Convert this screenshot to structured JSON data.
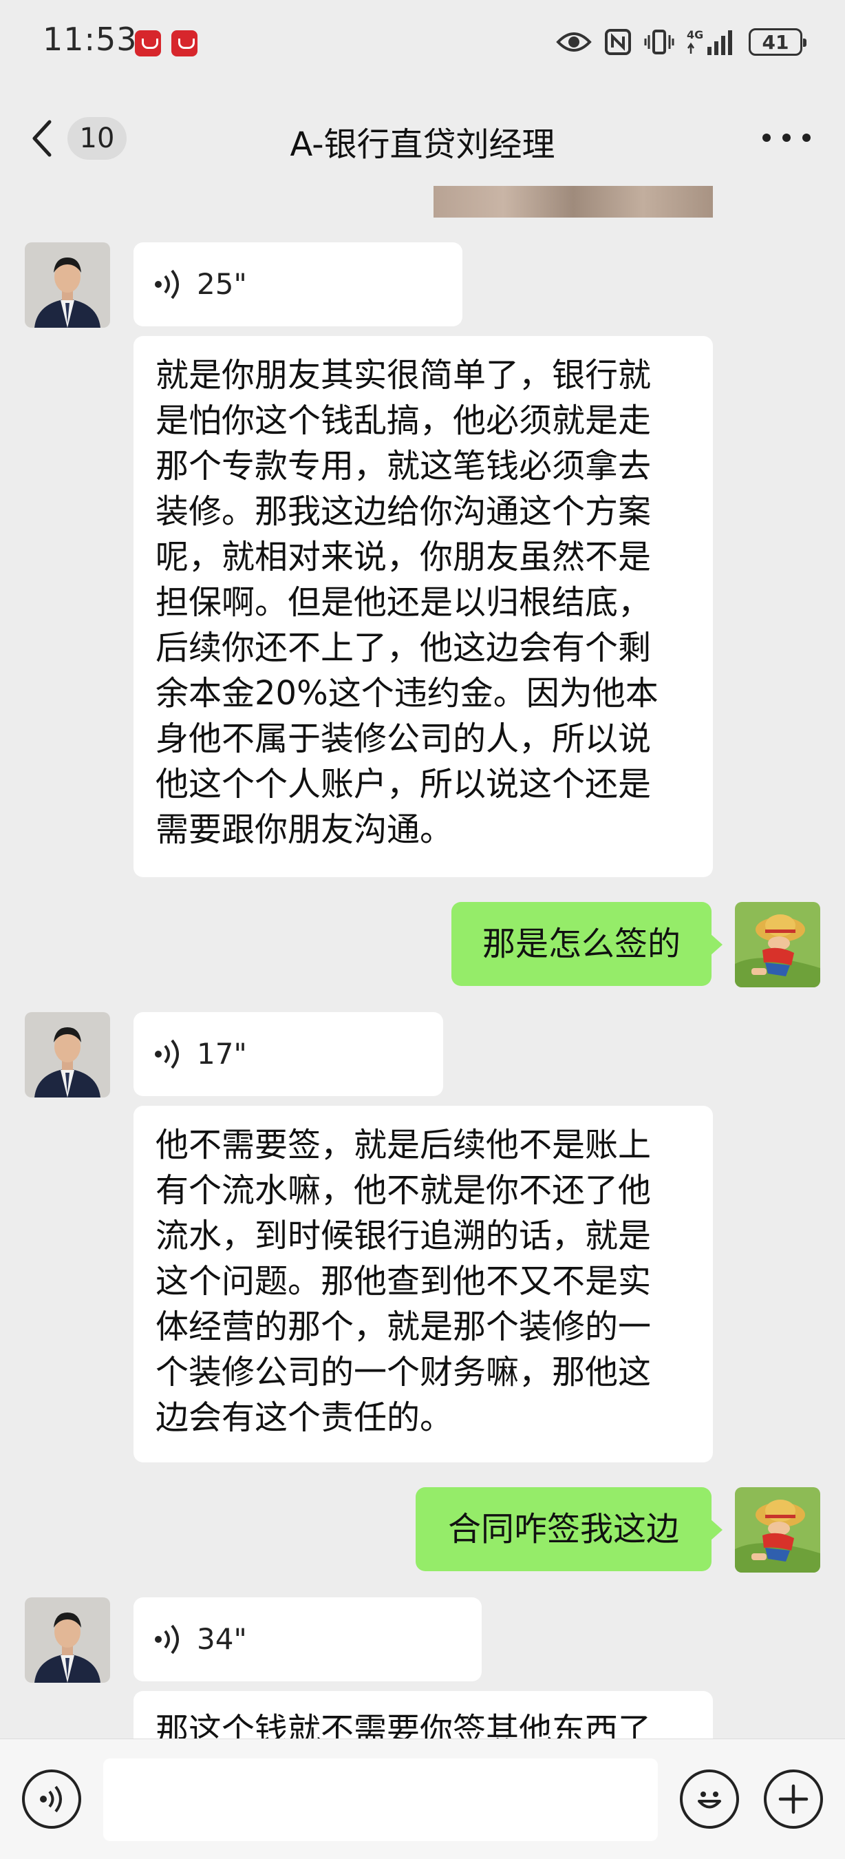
{
  "status_bar": {
    "time": "11:53",
    "battery": "41",
    "icons": [
      "huawei-app-icon",
      "huawei-app-icon",
      "eye-icon",
      "nfc-icon",
      "vibrate-icon",
      "4g-signal-icon",
      "battery-icon"
    ]
  },
  "nav": {
    "unread_count": "10",
    "title": "A-银行直贷刘经理"
  },
  "messages": [
    {
      "side": "left",
      "type": "voice",
      "duration": "25\""
    },
    {
      "side": "left",
      "type": "text",
      "text": "就是你朋友其实很简单了，银行就\n是怕你这个钱乱搞，他必须就是走\n那个专款专用，就这笔钱必须拿去\n装修。那我这边给你沟通这个方案\n呢，就相对来说，你朋友虽然不是\n担保啊。但是他还是以归根结底，\n后续你还不上了，他这边会有个剩\n余本金20%这个违约金。因为他本\n身他不属于装修公司的人，所以说\n他这个个人账户，所以说这个还是\n需要跟你朋友沟通。"
    },
    {
      "side": "right",
      "type": "text",
      "text": "那是怎么签的"
    },
    {
      "side": "left",
      "type": "voice",
      "duration": "17\""
    },
    {
      "side": "left",
      "type": "text",
      "text": "他不需要签，就是后续他不是账上\n有个流水嘛，他不就是你不还了他\n流水，到时候银行追溯的话，就是\n这个问题。那他查到他不又不是实\n体经营的那个，就是那个装修的一\n个装修公司的一个财务嘛，那他这\n边会有这个责任的。"
    },
    {
      "side": "right",
      "type": "text",
      "text": "合同咋签我这边"
    },
    {
      "side": "left",
      "type": "voice",
      "duration": "34\""
    },
    {
      "side": "left",
      "type": "text",
      "text": "那这个钱就不需要你签其他东西了"
    }
  ],
  "input_bar": {
    "voice_icon": "voice-input-icon",
    "emoji_icon": "emoji-icon",
    "plus_icon": "plus-icon"
  },
  "colors": {
    "background": "#ededed",
    "bubble_left": "#ffffff",
    "bubble_right": "#95ec69"
  }
}
